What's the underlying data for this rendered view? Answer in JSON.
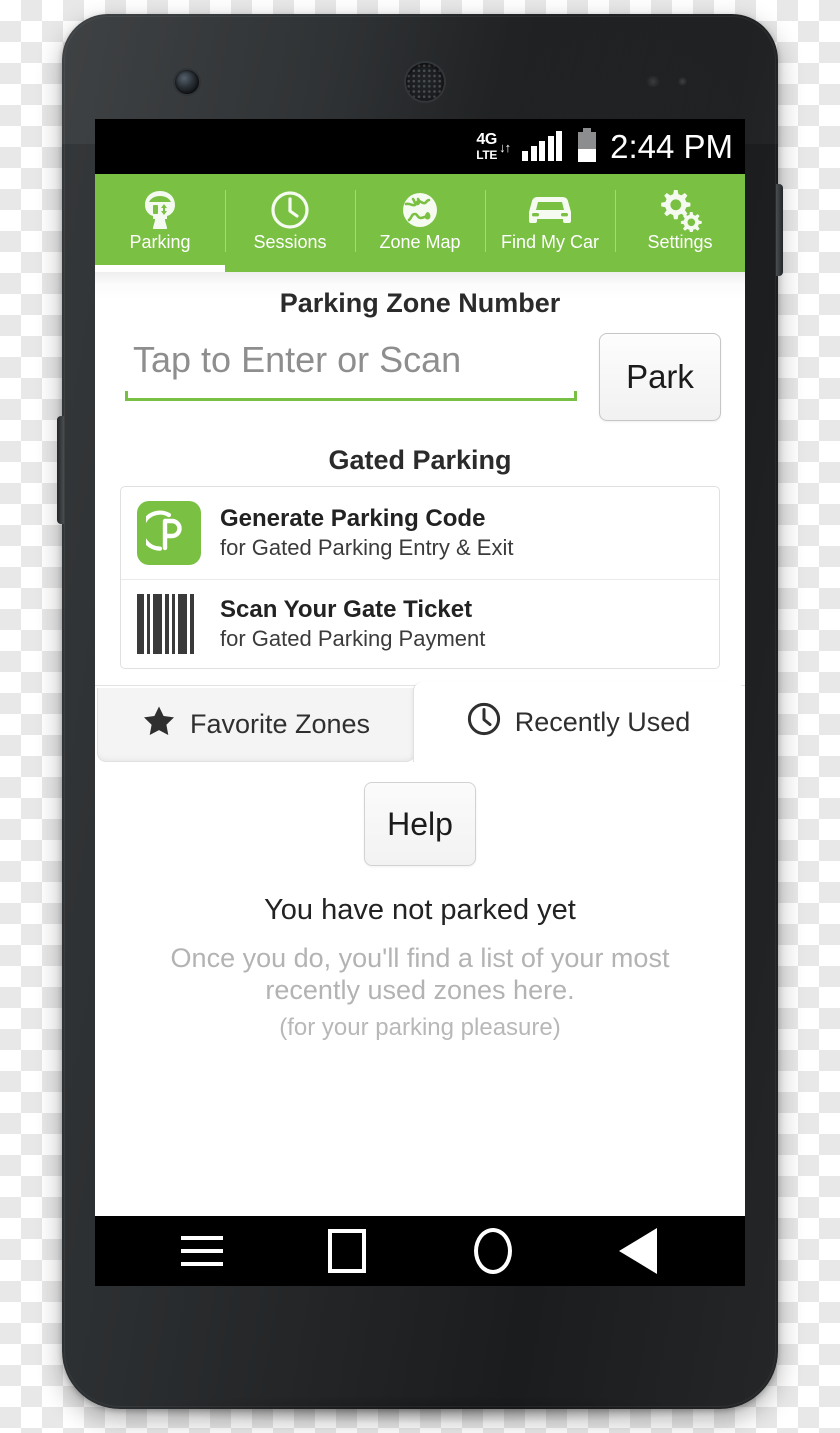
{
  "status_bar": {
    "network_4g": "4G",
    "network_lte": "LTE",
    "data_arrows": "↓↑",
    "signal_icon": "signal-bars-icon",
    "battery_icon": "battery-icon",
    "time": "2:44 PM"
  },
  "navbar": {
    "accent_color": "#7ac043",
    "tabs": [
      {
        "label": "Parking",
        "icon": "parking-meter-icon",
        "active": true
      },
      {
        "label": "Sessions",
        "icon": "clock-icon",
        "active": false
      },
      {
        "label": "Zone Map",
        "icon": "globe-icon",
        "active": false
      },
      {
        "label": "Find My Car",
        "icon": "car-icon",
        "active": false
      },
      {
        "label": "Settings",
        "icon": "gears-icon",
        "active": false
      }
    ]
  },
  "zone_entry": {
    "title": "Parking Zone Number",
    "input_value": "",
    "input_placeholder": "Tap to Enter or Scan",
    "park_button": "Park",
    "underline_color": "#77c043"
  },
  "gated_parking": {
    "title": "Gated Parking",
    "rows": [
      {
        "icon": "parkmobile-p-logo-icon",
        "title": "Generate Parking Code",
        "subtitle": "for Gated Parking Entry & Exit"
      },
      {
        "icon": "barcode-icon",
        "title": "Scan Your Gate Ticket",
        "subtitle": "for Gated Parking Payment"
      }
    ]
  },
  "sub_tabs": [
    {
      "label": "Favorite Zones",
      "icon": "star-icon",
      "active": false
    },
    {
      "label": "Recently Used",
      "icon": "clock-icon",
      "active": true
    }
  ],
  "empty_state": {
    "help_button": "Help",
    "title": "You have not parked yet",
    "description": "Once you do, you'll find a list of your most recently used zones here.",
    "note": "(for your parking pleasure)"
  },
  "android_nav": [
    {
      "icon": "menu-icon"
    },
    {
      "icon": "recents-square-icon"
    },
    {
      "icon": "home-circle-icon"
    },
    {
      "icon": "back-triangle-icon"
    }
  ]
}
